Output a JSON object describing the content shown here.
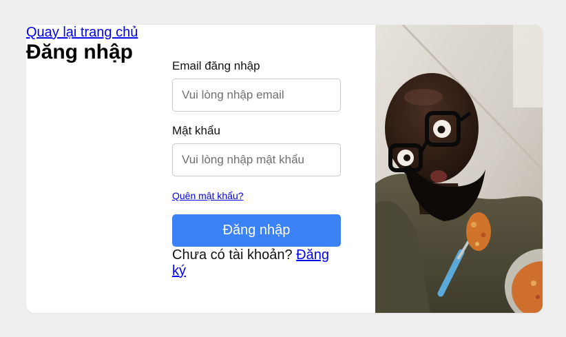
{
  "header": {
    "back_link": "Quay lại trang chủ",
    "title": "Đăng nhập"
  },
  "form": {
    "email_label": "Email đăng nhập",
    "email_placeholder": "Vui lòng nhập email",
    "email_value": "",
    "password_label": "Mật khẩu",
    "password_placeholder": "Vui lòng nhập mật khẩu",
    "password_value": "",
    "forgot_link": "Quên mật khẩu?",
    "submit_label": "Đăng nhập",
    "signup_prompt": "Chưa có tài khoản?",
    "signup_link": "Đăng ký"
  },
  "colors": {
    "page_background": "#efefef",
    "card_background": "#ffffff",
    "primary_button": "#3b82f6",
    "link": "#0000ee"
  },
  "hero_image": {
    "icon": "person-photo"
  }
}
